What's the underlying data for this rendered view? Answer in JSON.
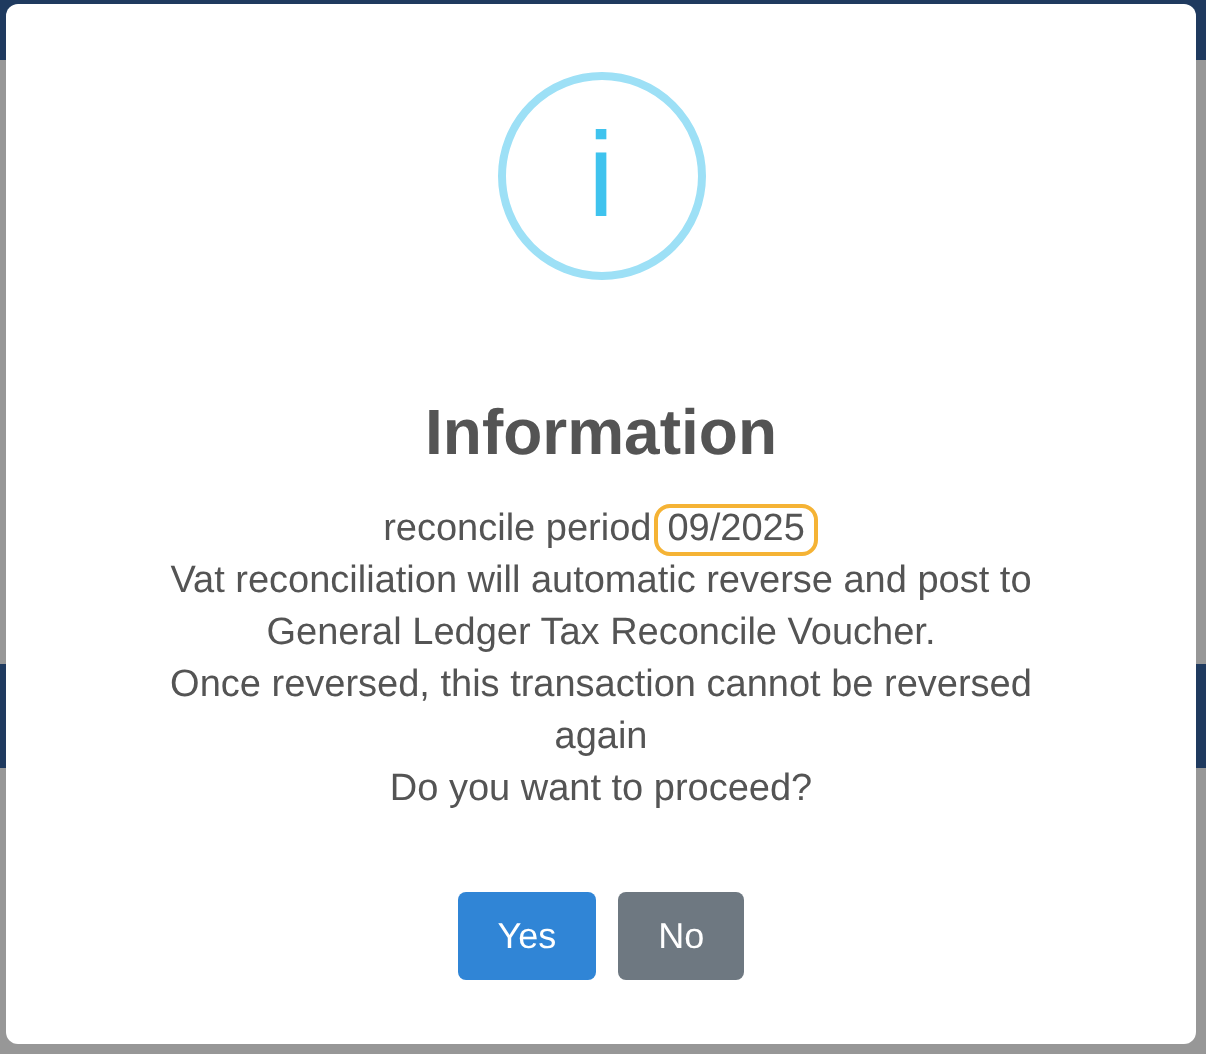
{
  "dialog": {
    "icon": "i",
    "title": "Information",
    "period_line": {
      "label": "reconcile period",
      "period": "09/2025"
    },
    "lines": [
      "Vat reconciliation will automatic reverse and post to General Ledger Tax Reconcile Voucher.",
      "Once reversed, this transaction cannot be reversed again",
      "Do you want to proceed?"
    ],
    "buttons": [
      {
        "label": "Yes",
        "kind": "confirm"
      },
      {
        "label": "No",
        "kind": "cancel"
      }
    ]
  }
}
